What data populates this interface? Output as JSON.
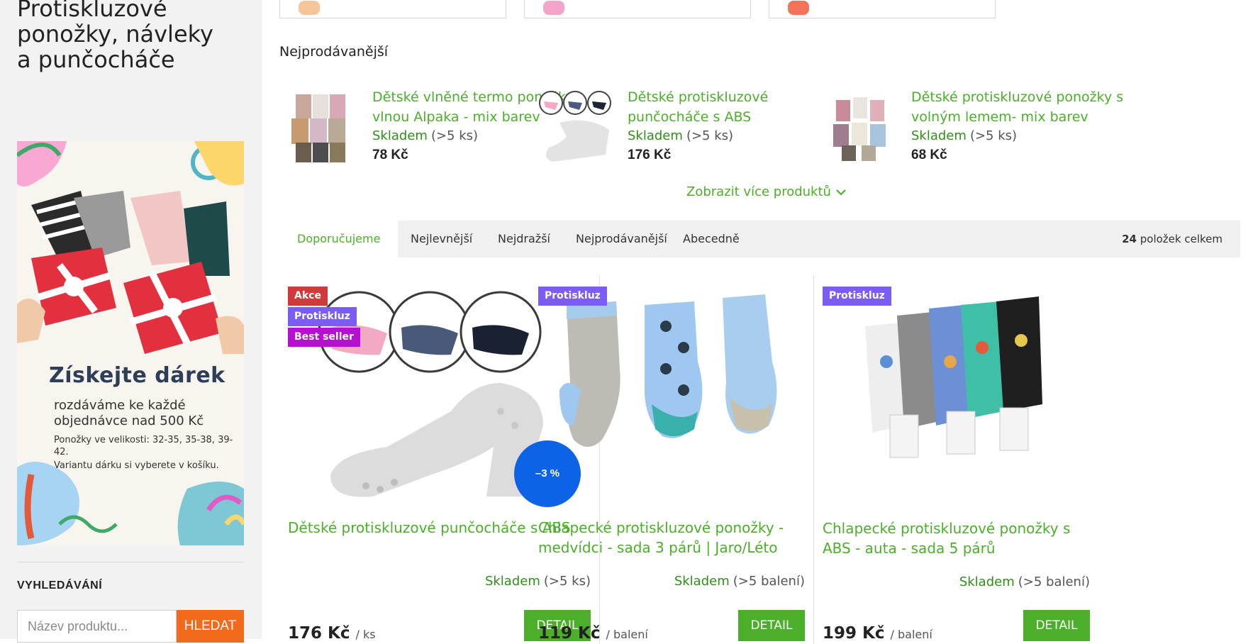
{
  "category_title": "Protiskluzové ponožky, návleky a punčocháče",
  "banner": {
    "heading": "Získejte dárek",
    "text": "rozdáváme ke každé objednávce nad 500 Kč",
    "sizes": "Ponožky ve velikosti: 32-35, 35-38, 39-42.",
    "note": "Variantu dárku si vyberete v košíku."
  },
  "search": {
    "heading": "VYHLEDÁVÁNÍ",
    "placeholder": "Název produktu...",
    "button": "HLEDAT"
  },
  "bestsellers": {
    "heading": "Nejprodávanější",
    "items": [
      {
        "name": "Dětské vlněné termo ponožky s vlnou Alpaka - mix barev",
        "stock": "Skladem",
        "stock_qty": "(>5 ks)",
        "price": "78 Kč"
      },
      {
        "name": "Dětské protiskluzové punčocháče s ABS",
        "stock": "Skladem",
        "stock_qty": "(>5 ks)",
        "price": "176 Kč"
      },
      {
        "name": "Dětské protiskluzové ponožky s volným lemem- mix barev",
        "stock": "Skladem",
        "stock_qty": "(>5 ks)",
        "price": "68 Kč"
      }
    ],
    "more": "Zobrazit více produktů"
  },
  "sort": {
    "tabs": [
      "Doporučujeme",
      "Nejlevnější",
      "Nejdražší",
      "Nejprodávanější",
      "Abecedně"
    ],
    "active": "Doporučujeme",
    "count_number": "24",
    "count_label": "položek celkem"
  },
  "products": [
    {
      "flags": [
        "Akce",
        "Protiskluz",
        "Best seller"
      ],
      "discount": "–3 %",
      "name": "Dětské protiskluzové punčocháče s ABS",
      "stock": "Skladem",
      "stock_qty": "(>5 ks)",
      "price": "176 Kč",
      "unit": "/ ks",
      "button": "DETAIL"
    },
    {
      "flags": [
        "Protiskluz"
      ],
      "name": "Chlapecké protiskluzové ponožky - medvídci - sada 3 párů | Jaro/Léto",
      "stock": "Skladem",
      "stock_qty": "(>5 balení)",
      "price": "119 Kč",
      "unit": "/ balení",
      "button": "DETAIL"
    },
    {
      "flags": [
        "Protiskluz"
      ],
      "name": "Chlapecké protiskluzové ponožky s ABS - auta - sada 5 párů",
      "stock": "Skladem",
      "stock_qty": "(>5 balení)",
      "price": "199 Kč",
      "unit": "/ balení",
      "button": "DETAIL"
    }
  ],
  "colors": {
    "accent_green": "#4caf2a",
    "search_button": "#f26a1b",
    "flag_akce": "#d13a3a",
    "flag_protiskluz": "#7b5cf5",
    "flag_best": "#b70fcf",
    "discount": "#0e62e6"
  }
}
